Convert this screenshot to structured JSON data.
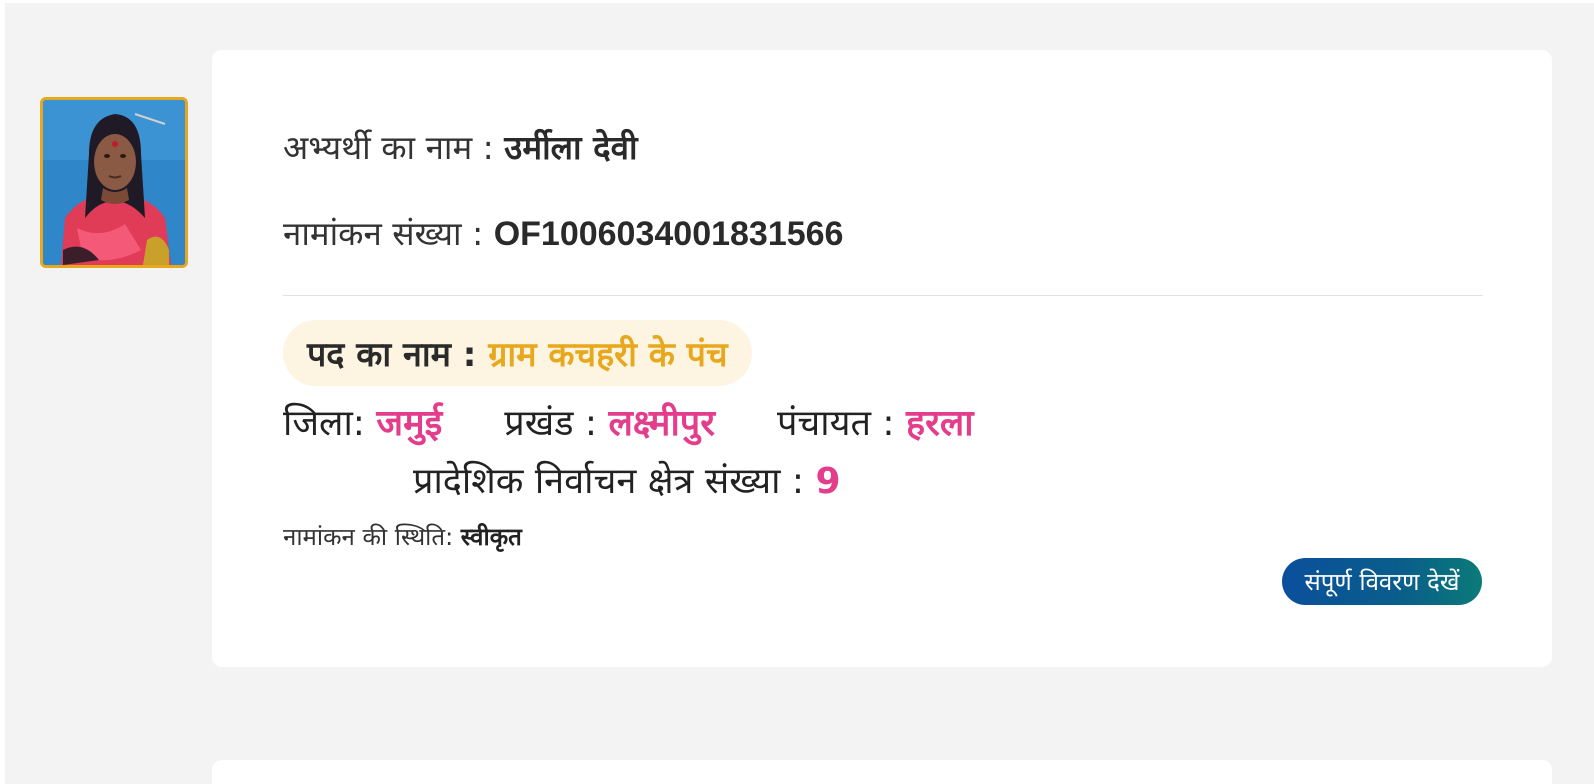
{
  "candidate": {
    "photo_icon": "candidate-photo",
    "name_label": "अभ्यर्थी का नाम :",
    "name_value": "उर्मीला देवी",
    "nomination_label": "नामांकन संख्या :",
    "nomination_value": "OF1006034001831566"
  },
  "post": {
    "label": "पद का नाम :",
    "value": "ग्राम कचहरी के पंच"
  },
  "location": {
    "district_label": "जिला:",
    "district_value": "जमुई",
    "block_label": "प्रखंड :",
    "block_value": "लक्ष्मीपुर",
    "panchayat_label": "पंचायत :",
    "panchayat_value": "हरला",
    "constituency_label": "प्रादेशिक निर्वाचन क्षेत्र संख्या :",
    "constituency_value": "9"
  },
  "status": {
    "label": "नामांकन की स्थिति:",
    "value": "स्वीकृत"
  },
  "actions": {
    "details_label": "संपूर्ण विवरण देखें"
  },
  "colors": {
    "accent_orange": "#e8a81e",
    "accent_pink": "#e33d8c",
    "button_blue": "#0b4f9c",
    "button_teal": "#0b7a78"
  }
}
